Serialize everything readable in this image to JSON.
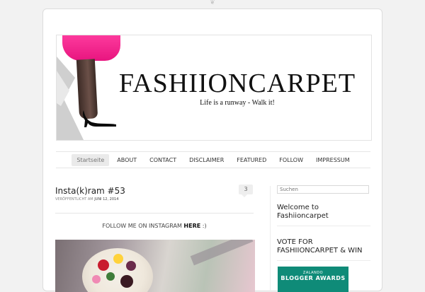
{
  "header": {
    "brand": "FASHIIONCARPET",
    "tagline": "Life is a runway - Walk it!"
  },
  "nav": {
    "items": [
      "Startseite",
      "ABOUT",
      "CONTACT",
      "DISCLAIMER",
      "FEATURED",
      "FOLLOW",
      "IMPRESSUM"
    ]
  },
  "post": {
    "title": "Insta(k)ram #53",
    "comment_count": "3",
    "meta_prefix": "VERÖFFENTLICHT AM",
    "date": "JUNI 12, 2014",
    "follow_text": "FOLLOW ME ON INSTAGRAM",
    "follow_link": "HERE",
    "follow_suffix": ":)"
  },
  "sidebar": {
    "search_placeholder": "Suchen",
    "welcome_title": "Welcome to Fashiioncarpet",
    "vote_title": "VOTE FOR FASHIIONCARPET & WIN",
    "award_small": "ZALANDO",
    "award_big": "BLOGGER AWARDS"
  },
  "colors": {
    "accent": "#e8157f",
    "award": "#0f8b78"
  }
}
